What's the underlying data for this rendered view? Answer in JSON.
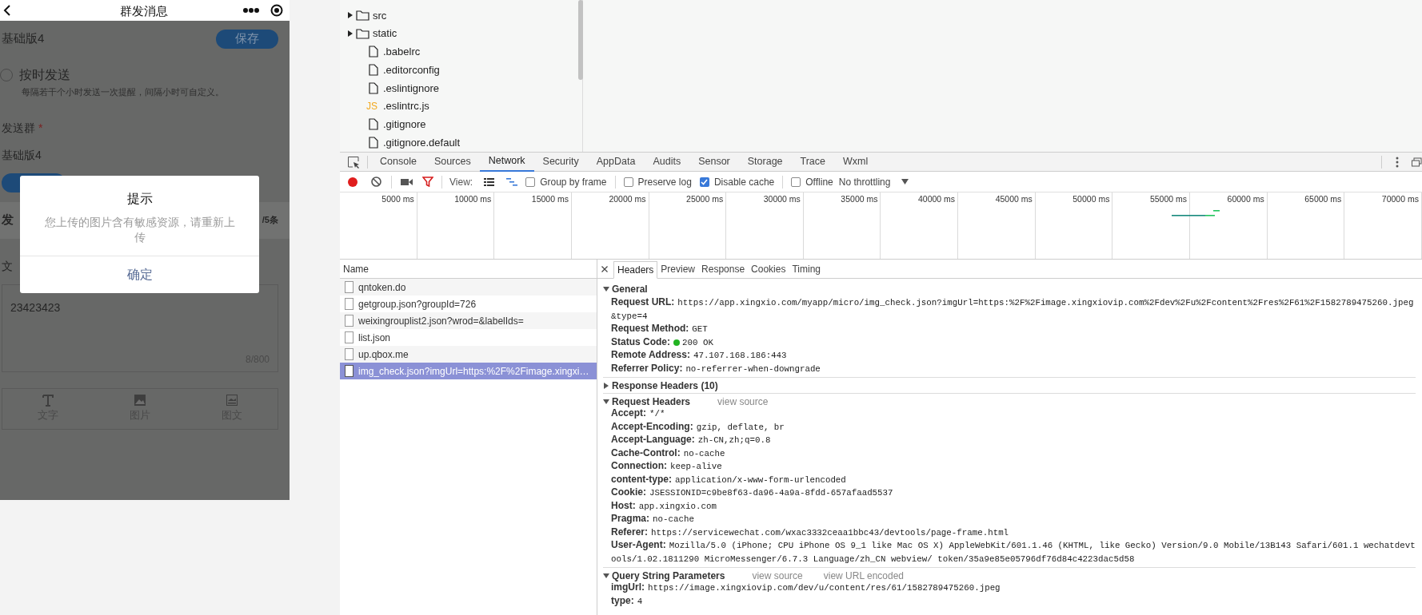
{
  "phone": {
    "title": "群发消息",
    "group_name": "基础版4",
    "save_button": "保存",
    "schedule_option": {
      "label": "按时发送",
      "hint": "每隔若干个小时发送一次提醒，间隔小时可自定义。",
      "selected": false
    },
    "group_label": "发送群",
    "required_mark": "*",
    "group_value": "基础版4",
    "section_title": "发",
    "section_count": "/5条",
    "text_label": "文",
    "text_value": "23423423",
    "char_count": "8/800",
    "content_types": [
      {
        "kind": "text",
        "label": "文字"
      },
      {
        "kind": "image",
        "label": "图片"
      },
      {
        "kind": "article",
        "label": "图文"
      }
    ]
  },
  "dialog": {
    "title": "提示",
    "message": "您上传的图片含有敏感资源，请重新上传",
    "confirm": "确定"
  },
  "file_tree": [
    {
      "name": "src",
      "kind": "folder",
      "expanded": false
    },
    {
      "name": "static",
      "kind": "folder",
      "expanded": false
    },
    {
      "name": ".babelrc",
      "kind": "file"
    },
    {
      "name": ".editorconfig",
      "kind": "file"
    },
    {
      "name": ".eslintignore",
      "kind": "file"
    },
    {
      "name": ".eslintrc.js",
      "kind": "js",
      "badge": "JS"
    },
    {
      "name": ".gitignore",
      "kind": "file"
    },
    {
      "name": ".gitignore.default",
      "kind": "file"
    }
  ],
  "devtools_tabs": [
    {
      "label": "Console",
      "selected": false
    },
    {
      "label": "Sources",
      "selected": false
    },
    {
      "label": "Network",
      "selected": true
    },
    {
      "label": "Security",
      "selected": false
    },
    {
      "label": "AppData",
      "selected": false
    },
    {
      "label": "Audits",
      "selected": false
    },
    {
      "label": "Sensor",
      "selected": false
    },
    {
      "label": "Storage",
      "selected": false
    },
    {
      "label": "Trace",
      "selected": false
    },
    {
      "label": "Wxml",
      "selected": false
    }
  ],
  "toolbar": {
    "recording": true,
    "view_label": "View:",
    "view_modes": [
      {
        "kind": "list",
        "selected": false
      },
      {
        "kind": "waterfall",
        "selected": true
      }
    ],
    "checkboxes": [
      {
        "label": "Group by frame",
        "checked": false
      },
      {
        "label": "Preserve log",
        "checked": false
      },
      {
        "label": "Disable cache",
        "checked": true
      },
      {
        "label": "Offline",
        "checked": false
      }
    ],
    "throttling": "No throttling"
  },
  "timeline": {
    "ticks": [
      "5000 ms",
      "10000 ms",
      "15000 ms",
      "20000 ms",
      "25000 ms",
      "30000 ms",
      "35000 ms",
      "40000 ms",
      "45000 ms",
      "50000 ms",
      "55000 ms",
      "60000 ms",
      "65000 ms",
      "70000 ms"
    ]
  },
  "requests": {
    "column": "Name",
    "rows": [
      {
        "name": "qntoken.do",
        "selected": false
      },
      {
        "name": "getgroup.json?groupId=726",
        "selected": false
      },
      {
        "name": "weixingrouplist2.json?wrod=&labelIds=",
        "selected": false
      },
      {
        "name": "list.json",
        "selected": false
      },
      {
        "name": "up.qbox.me",
        "selected": false
      },
      {
        "name": "img_check.json?imgUrl=https:%2F%2Fimage.xingxi…",
        "selected": true
      }
    ]
  },
  "detail_tabs": [
    {
      "label": "Headers",
      "selected": true
    },
    {
      "label": "Preview",
      "selected": false
    },
    {
      "label": "Response",
      "selected": false
    },
    {
      "label": "Cookies",
      "selected": false
    },
    {
      "label": "Timing",
      "selected": false
    }
  ],
  "sections": [
    {
      "title": "General",
      "expanded": true,
      "fields": [
        {
          "name": "Request URL:",
          "value": "https://app.xingxio.com/myapp/micro/img_check.json?imgUrl=https:%2F%2Fimage.xingxiovip.com%2Fdev%2Fu%2Fcontent%2Fres%2F61%2F1582789475260.jpeg&type=4"
        },
        {
          "name": "Request Method:",
          "value": "GET"
        },
        {
          "name": "Status Code:",
          "value": "200 OK",
          "color": "#22b422"
        },
        {
          "name": "Remote Address:",
          "value": "47.107.168.186:443"
        },
        {
          "name": "Referrer Policy:",
          "value": "no-referrer-when-downgrade"
        }
      ]
    },
    {
      "title": "Response Headers (10)",
      "expanded": false
    },
    {
      "title": "Request Headers",
      "expanded": true,
      "links": [
        "view source"
      ],
      "fields": [
        {
          "name": "Accept:",
          "value": "*/*"
        },
        {
          "name": "Accept-Encoding:",
          "value": "gzip, deflate, br"
        },
        {
          "name": "Accept-Language:",
          "value": "zh-CN,zh;q=0.8"
        },
        {
          "name": "Cache-Control:",
          "value": "no-cache"
        },
        {
          "name": "Connection:",
          "value": "keep-alive"
        },
        {
          "name": "content-type:",
          "value": "application/x-www-form-urlencoded"
        },
        {
          "name": "Cookie:",
          "value": "JSESSIONID=c9be8f63-da96-4a9a-8fdd-657afaad5537"
        },
        {
          "name": "Host:",
          "value": "app.xingxio.com"
        },
        {
          "name": "Pragma:",
          "value": "no-cache"
        },
        {
          "name": "Referer:",
          "value": "https://servicewechat.com/wxac3332ceaa1bbc43/devtools/page-frame.html"
        },
        {
          "name": "User-Agent:",
          "value": "Mozilla/5.0 (iPhone; CPU iPhone OS 9_1 like Mac OS X) AppleWebKit/601.1.46 (KHTML, like Gecko) Version/9.0 Mobile/13B143 Safari/601.1 wechatdevtools/1.02.1811290 MicroMessenger/6.7.3 Language/zh_CN webview/ token/35a9e85e05796df76d84c4223dac5d58"
        }
      ]
    },
    {
      "title": "Query String Parameters",
      "expanded": true,
      "links": [
        "view source",
        "view URL encoded"
      ],
      "fields": [
        {
          "name": "imgUrl:",
          "value": "https://image.xingxiovip.com/dev/u/content/res/61/1582789475260.jpeg"
        },
        {
          "name": "type:",
          "value": "4"
        }
      ]
    }
  ]
}
